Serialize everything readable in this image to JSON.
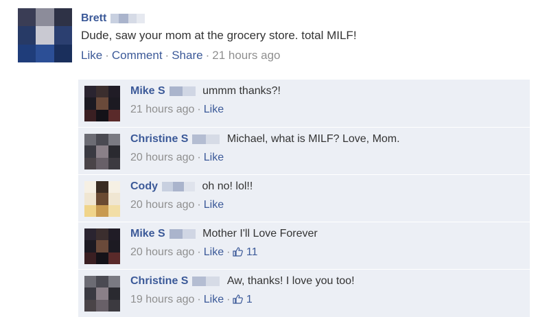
{
  "post": {
    "author": "Brett",
    "text": "Dude, saw your mom at the grocery store. total MILF!",
    "actions": {
      "like": "Like",
      "comment": "Comment",
      "share": "Share",
      "time": "21 hours ago"
    }
  },
  "comments": [
    {
      "name": "Mike S",
      "text": "ummm thanks?!",
      "time": "21 hours ago",
      "like": "Like",
      "likes": ""
    },
    {
      "name": "Christine S",
      "text": "Michael, what is MILF? Love, Mom.",
      "time": "20 hours ago",
      "like": "Like",
      "likes": ""
    },
    {
      "name": "Cody",
      "text": "oh no! lol!!",
      "time": "20 hours ago",
      "like": "Like",
      "likes": ""
    },
    {
      "name": "Mike S",
      "text": "Mother I'll Love Forever",
      "time": "20 hours ago",
      "like": "Like",
      "likes": "11"
    },
    {
      "name": "Christine S",
      "text": "Aw, thanks! I love you too!",
      "time": "19 hours ago",
      "like": "Like",
      "likes": "1"
    }
  ],
  "separator": "·",
  "colors": {
    "link": "#3b5998",
    "muted": "#8f8f8f",
    "comment_bg": "#eceff5"
  }
}
